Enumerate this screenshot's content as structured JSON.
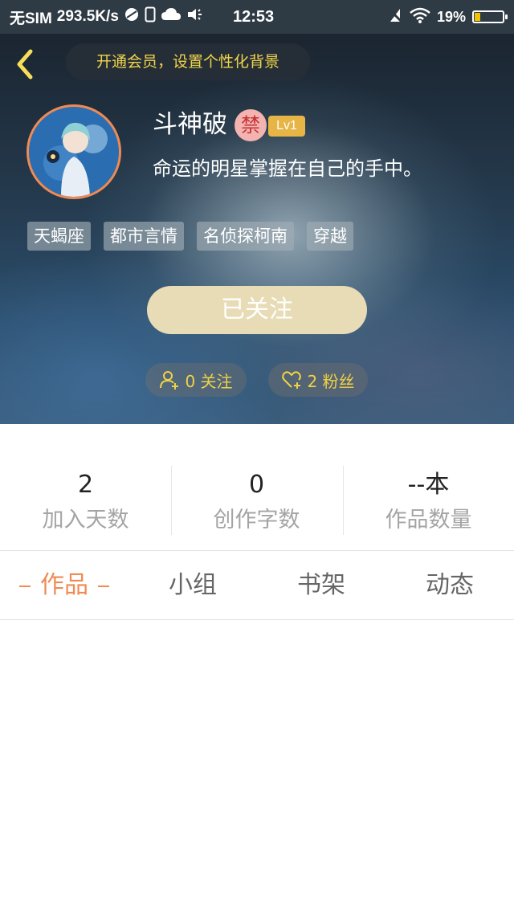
{
  "status_bar": {
    "carrier": "无SIM",
    "speed": "293.5K/s",
    "time": "12:53",
    "battery": "19%"
  },
  "header": {
    "promo": "开通会员，设置个性化背景",
    "user_name": "斗神破",
    "ban_badge": "禁",
    "level": "Lv1",
    "bio": "命运的明星掌握在自己的手中。",
    "tags": [
      "天蝎座",
      "都市言情",
      "名侦探柯南",
      "穿越"
    ],
    "follow_button": "已关注",
    "following": "0 关注",
    "fans": "2 粉丝"
  },
  "stats": [
    {
      "value": "2",
      "label": "加入天数"
    },
    {
      "value": "0",
      "label": "创作字数"
    },
    {
      "value": "--本",
      "label": "作品数量"
    }
  ],
  "tabs": [
    "作品",
    "小组",
    "书架",
    "动态"
  ],
  "colors": {
    "accent": "#ef8b55",
    "gold": "#f0d146",
    "follow_button_bg": "#e7dcb6"
  }
}
